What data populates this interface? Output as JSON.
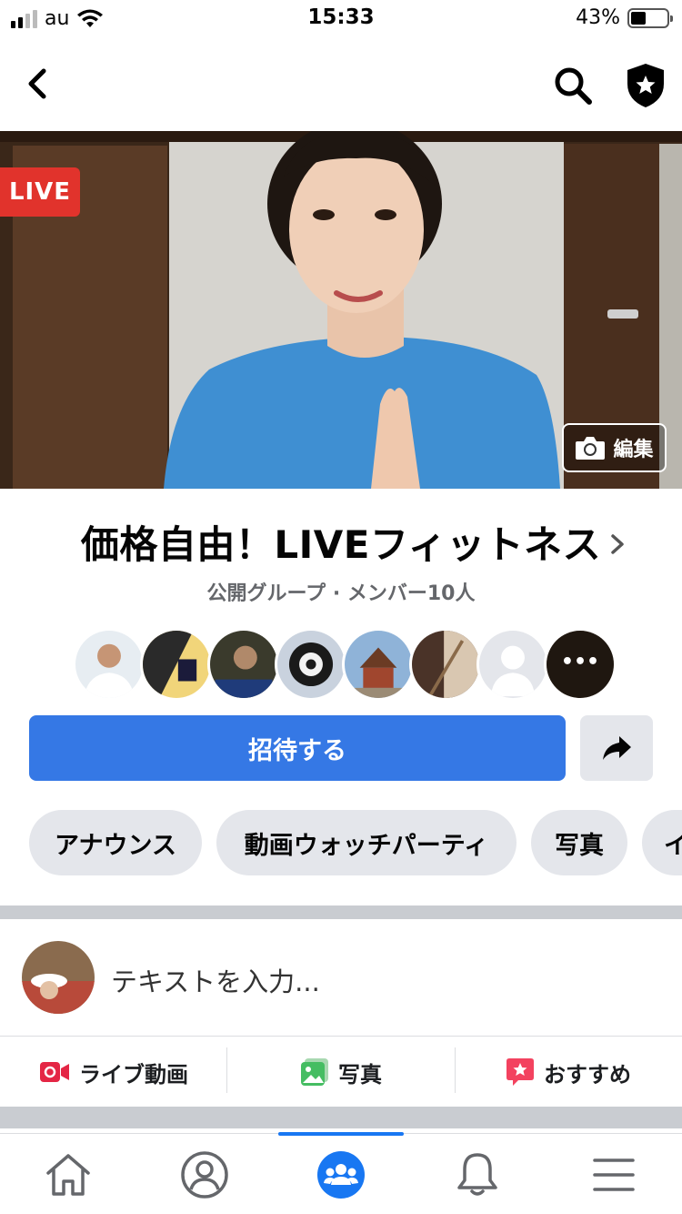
{
  "status_bar": {
    "carrier": "au",
    "time": "15:33",
    "battery": "43%",
    "battery_level": 0.43
  },
  "nav": {
    "back_icon": "back-chevron-icon",
    "search_icon": "search-icon",
    "shield_icon": "admin-shield-icon"
  },
  "cover": {
    "live_label": "LIVE",
    "edit_label": "編集"
  },
  "group": {
    "title": "価格自由！LIVEフィットネス",
    "meta": "公開グループ · メンバー10人"
  },
  "members": {
    "more_label": "•••"
  },
  "invite": {
    "label": "招待する"
  },
  "chips": [
    "アナウンス",
    "動画ウォッチパーティ",
    "写真",
    "イ"
  ],
  "composer": {
    "placeholder": "テキストを入力..."
  },
  "actions": [
    {
      "label": "ライブ動画",
      "icon": "live-video-icon",
      "color": "#e42645"
    },
    {
      "label": "写真",
      "icon": "photo-icon",
      "color": "#45bd62"
    },
    {
      "label": "おすすめ",
      "icon": "recommend-icon",
      "color": "#f3425f"
    }
  ],
  "tabs": [
    "home-icon",
    "profile-icon",
    "groups-icon",
    "notifications-icon",
    "menu-icon"
  ],
  "colors": {
    "accent": "#3578e5",
    "live": "#e1332c",
    "chip_bg": "#e4e6eb"
  }
}
